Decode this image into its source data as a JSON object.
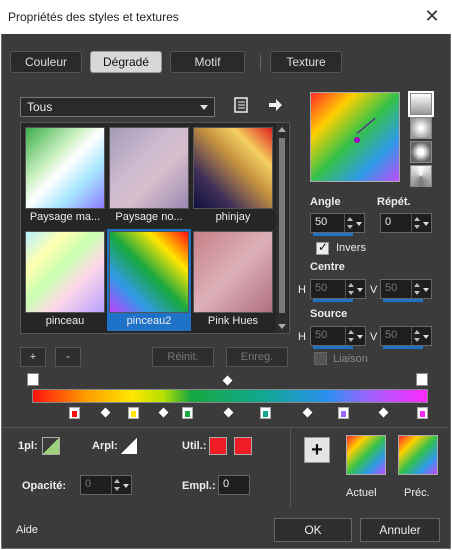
{
  "window": {
    "title": "Propriétés des styles et textures",
    "close_glyph": "✕"
  },
  "tabs": [
    {
      "label": "Couleur",
      "active": false
    },
    {
      "label": "Dégradé",
      "active": true
    },
    {
      "label": "Motif",
      "active": false
    },
    {
      "label": "Texture",
      "active": false
    }
  ],
  "category": {
    "selected": "Tous"
  },
  "gallery": {
    "items": [
      {
        "label": "Paysage ma..."
      },
      {
        "label": "Paysage no..."
      },
      {
        "label": "phinjay"
      },
      {
        "label": "pinceau"
      },
      {
        "label": "pinceau2",
        "selected": true
      },
      {
        "label": "Pink Hues"
      }
    ]
  },
  "gallery_buttons": {
    "add": "+",
    "remove": "-",
    "reset": "Réinit.",
    "save": "Enreg."
  },
  "angle": {
    "label": "Angle",
    "value": "50"
  },
  "repeat": {
    "label": "Répét.",
    "value": "0"
  },
  "invert": {
    "label": "Invers",
    "checked": true
  },
  "center": {
    "label": "Centre",
    "h_label": "H",
    "h_value": "50",
    "v_label": "V",
    "v_value": "50"
  },
  "source": {
    "label": "Source",
    "h_label": "H",
    "h_value": "50",
    "v_label": "V",
    "v_value": "50"
  },
  "link": {
    "label": "Liaison",
    "checked": false
  },
  "gradient_stops": [
    "#ff1010",
    "#ffe600",
    "#18a840",
    "#10a890",
    "#9c64ff",
    "#ff28ff"
  ],
  "lower": {
    "first_plane_label": "1pl:",
    "back_plane_label": "Arpl:",
    "user_label": "Util.:",
    "opacity_label": "Opacité:",
    "opacity_value": "0",
    "location_label": "Empl.:",
    "location_value": "0",
    "user_color": "#ee1c24"
  },
  "current_label": "Actuel",
  "previous_label": "Préc.",
  "footer": {
    "help": "Aide",
    "ok": "OK",
    "cancel": "Annuler"
  }
}
